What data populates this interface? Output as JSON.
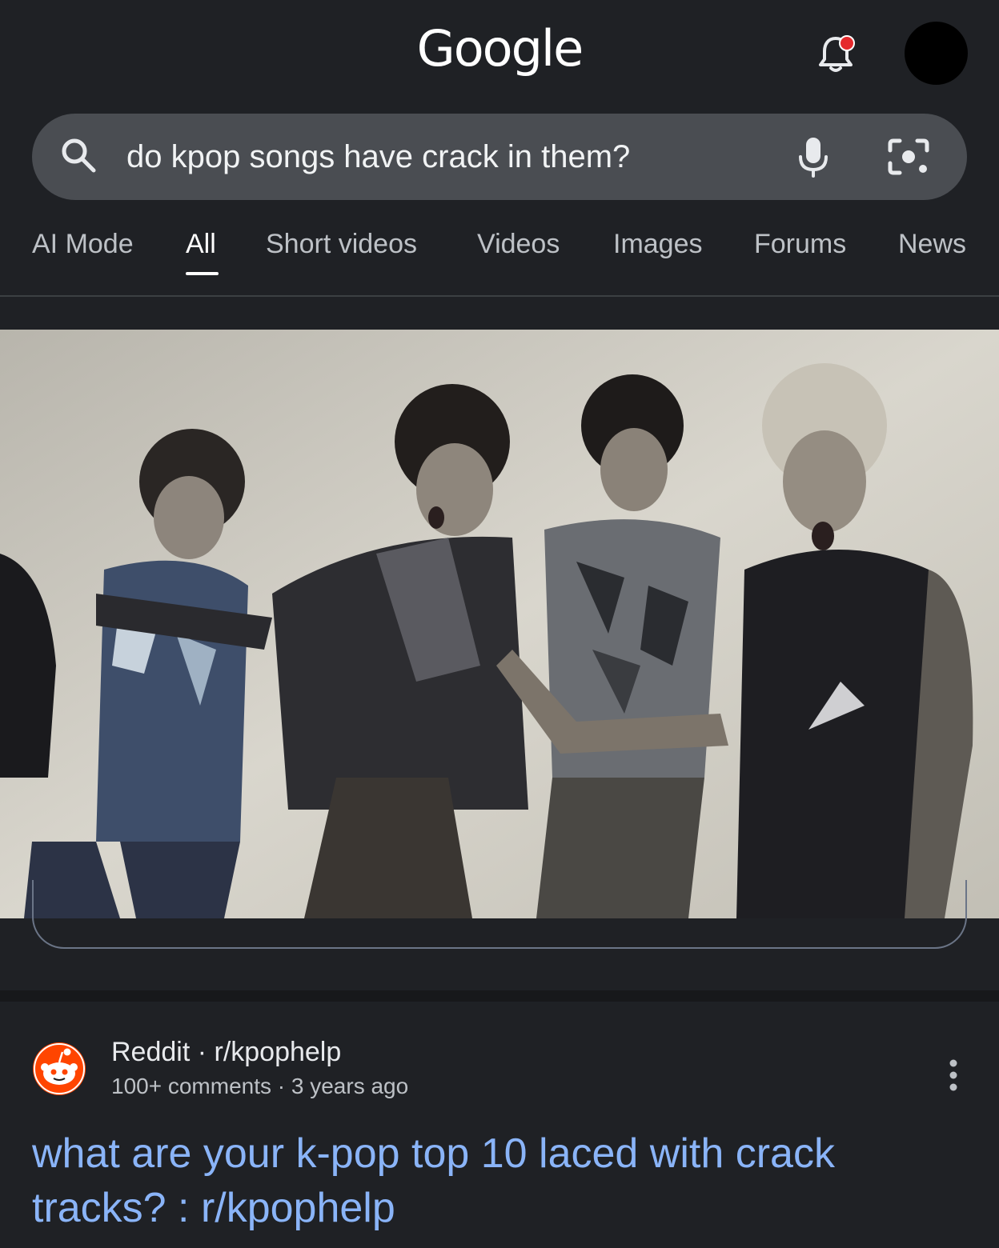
{
  "header": {
    "logo_text": "Google",
    "notification_icon": "bell-icon",
    "has_notification": true,
    "accent_dot_color": "#e5292c"
  },
  "search": {
    "query": "do kpop songs have crack in them?",
    "search_icon": "search-icon",
    "voice_icon": "mic-icon",
    "lens_icon": "camera-lens-icon"
  },
  "tabs": {
    "items": [
      {
        "label": "AI Mode"
      },
      {
        "label": "All"
      },
      {
        "label": "Short videos"
      },
      {
        "label": "Videos"
      },
      {
        "label": "Images"
      },
      {
        "label": "Forums"
      },
      {
        "label": "News"
      }
    ],
    "active": "All"
  },
  "media_card": {
    "kind": "video-thumbnail",
    "subject_icon": "kpop-group-dance-thumbnail"
  },
  "result": {
    "source": "Reddit · r/kpophelp",
    "meta": "100+ comments · 3 years ago",
    "title": "what are your k-pop top 10 laced with crack tracks? : r/kpophelp",
    "link_color": "#8ab4f8",
    "source_icon": "reddit-icon",
    "menu_icon": "more-vert-icon"
  }
}
